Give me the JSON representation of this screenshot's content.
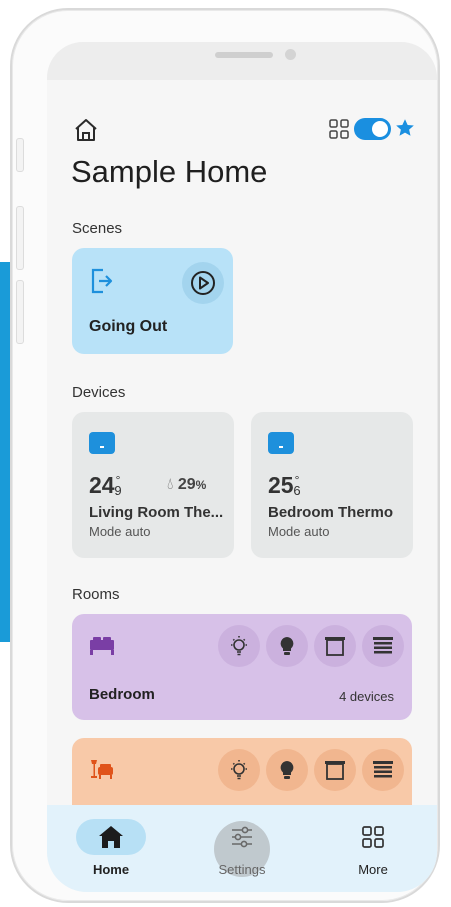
{
  "header": {
    "title": "Sample Home",
    "home_icon": "home-outline-icon",
    "view_icon": "grid-icon",
    "star_icon": "star-icon",
    "toggle_on": true,
    "accent_color": "#1a8fe0"
  },
  "scenes": {
    "section_label": "Scenes",
    "items": [
      {
        "label": "Going Out",
        "icon": "exit-icon",
        "color": "#b8e2f8"
      }
    ]
  },
  "devices": {
    "section_label": "Devices",
    "items": [
      {
        "temp_whole": "24",
        "temp_decimal": "9",
        "degree": "°",
        "humidity_value": "29",
        "humidity_unit": "%",
        "name": "Living Room The...",
        "mode": "Mode auto"
      },
      {
        "temp_whole": "25",
        "temp_decimal": "6",
        "degree": "°",
        "name": "Bedroom Thermo",
        "mode": "Mode auto"
      }
    ]
  },
  "rooms": {
    "section_label": "Rooms",
    "items": [
      {
        "name": "Bedroom",
        "count": "4 devices",
        "icon": "bed-icon",
        "color": "#d7c1e8"
      },
      {
        "name": "",
        "count": "",
        "icon": "armchair-lamp-icon",
        "color": "#f8c9a8"
      }
    ]
  },
  "nav": {
    "items": [
      {
        "label": "Home",
        "icon": "home-filled-icon",
        "active": true
      },
      {
        "label": "Settings",
        "icon": "sliders-icon",
        "active": false
      },
      {
        "label": "More",
        "icon": "grid-icon",
        "active": false
      }
    ]
  }
}
